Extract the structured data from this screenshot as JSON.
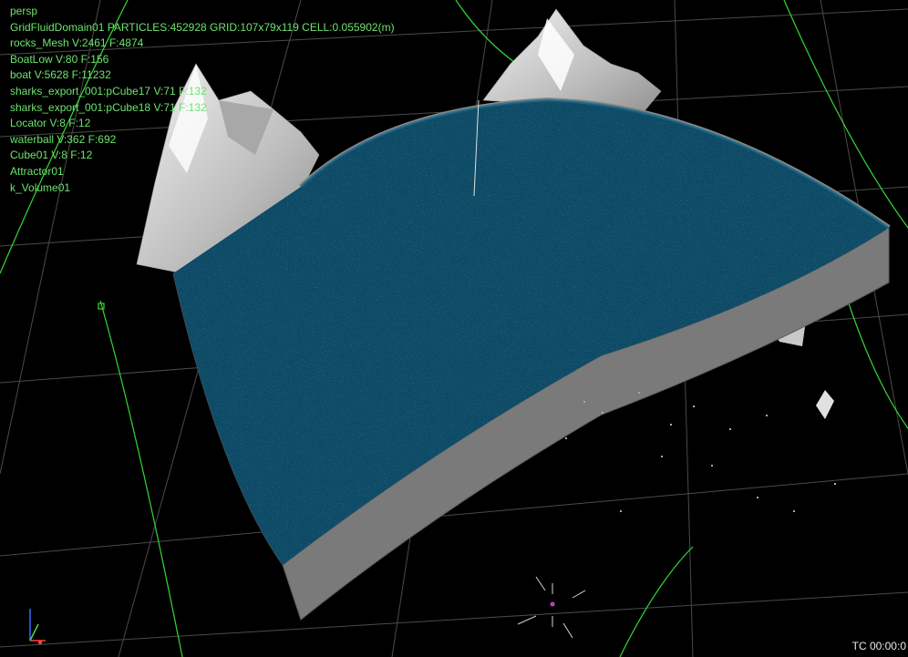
{
  "viewport": {
    "camera_label": "persp",
    "hud_lines": [
      "GridFluidDomain01 PARTICLES:452928 GRID:107x79x119 CELL:0.055902(m)",
      "rocks_Mesh V:2461 F:4874",
      "BoatLow V:80 F:156",
      "boat V:5628 F:11232",
      "sharks_export_001:pCube17 V:71 F:132",
      "sharks_export_001:pCube18 V:71 F:132",
      "Locator V:8 F:12",
      "waterball V:362 F:692",
      "Cube01 V:8 F:12",
      "Attractor01",
      "k_Volume01"
    ],
    "timecode": "TC 00:00:0"
  },
  "colors": {
    "background": "#000000",
    "grid_line": "#4a4a4a",
    "domain_guide": "#35d935",
    "hud_text": "#6ee36e",
    "water": "#0d4a66",
    "foam": "#b8c8d0",
    "container_wall": "#7a7a7a",
    "rock": "#cfcfcf"
  },
  "icons": {
    "axis_gizmo": "xyz-axis-gizmo-icon",
    "attractor": "attractor-crosshair-icon"
  }
}
